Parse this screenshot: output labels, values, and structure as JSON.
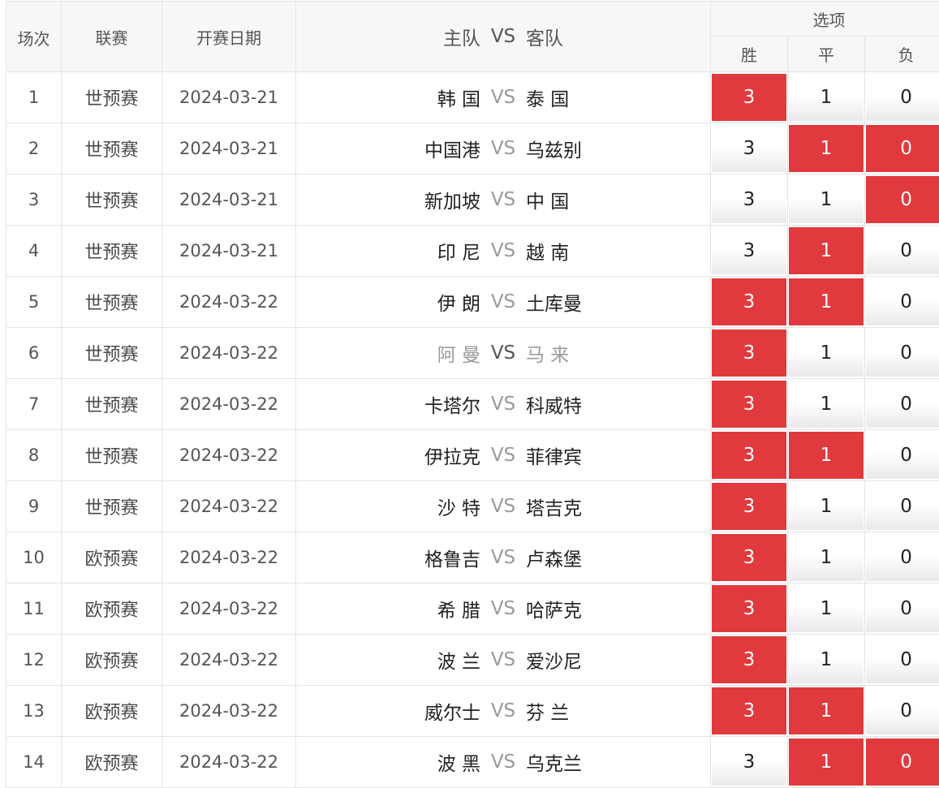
{
  "header": {
    "num": "场次",
    "league": "联赛",
    "date": "开赛日期",
    "home_team": "主队",
    "vs": "VS",
    "away_team": "客队",
    "options": "选项",
    "win": "胜",
    "draw": "平",
    "lose": "负"
  },
  "colors": {
    "selected": "#e03a3e",
    "muted_team": "#9a9a9a",
    "border": "#e4e4e4",
    "header_bg": "#f7f7f7"
  },
  "matches": [
    {
      "num": "1",
      "league": "世预赛",
      "date": "2024-03-21",
      "home": "韩 国",
      "vs": "VS",
      "away": "泰 国",
      "win": "3",
      "draw": "1",
      "lose": "0",
      "selected": [
        true,
        false,
        false
      ],
      "muted": false
    },
    {
      "num": "2",
      "league": "世预赛",
      "date": "2024-03-21",
      "home": "中国港",
      "vs": "VS",
      "away": "乌兹别",
      "win": "3",
      "draw": "1",
      "lose": "0",
      "selected": [
        false,
        true,
        true
      ],
      "muted": false
    },
    {
      "num": "3",
      "league": "世预赛",
      "date": "2024-03-21",
      "home": "新加坡",
      "vs": "VS",
      "away": "中 国",
      "win": "3",
      "draw": "1",
      "lose": "0",
      "selected": [
        false,
        false,
        true
      ],
      "muted": false
    },
    {
      "num": "4",
      "league": "世预赛",
      "date": "2024-03-21",
      "home": "印 尼",
      "vs": "VS",
      "away": "越 南",
      "win": "3",
      "draw": "1",
      "lose": "0",
      "selected": [
        false,
        true,
        false
      ],
      "muted": false
    },
    {
      "num": "5",
      "league": "世预赛",
      "date": "2024-03-22",
      "home": "伊 朗",
      "vs": "VS",
      "away": "土库曼",
      "win": "3",
      "draw": "1",
      "lose": "0",
      "selected": [
        true,
        true,
        false
      ],
      "muted": false
    },
    {
      "num": "6",
      "league": "世预赛",
      "date": "2024-03-22",
      "home": "阿 曼",
      "vs": "VS",
      "away": "马 来",
      "win": "3",
      "draw": "1",
      "lose": "0",
      "selected": [
        true,
        false,
        false
      ],
      "muted": true
    },
    {
      "num": "7",
      "league": "世预赛",
      "date": "2024-03-22",
      "home": "卡塔尔",
      "vs": "VS",
      "away": "科威特",
      "win": "3",
      "draw": "1",
      "lose": "0",
      "selected": [
        true,
        false,
        false
      ],
      "muted": false
    },
    {
      "num": "8",
      "league": "世预赛",
      "date": "2024-03-22",
      "home": "伊拉克",
      "vs": "VS",
      "away": "菲律宾",
      "win": "3",
      "draw": "1",
      "lose": "0",
      "selected": [
        true,
        true,
        false
      ],
      "muted": false
    },
    {
      "num": "9",
      "league": "世预赛",
      "date": "2024-03-22",
      "home": "沙 特",
      "vs": "VS",
      "away": "塔吉克",
      "win": "3",
      "draw": "1",
      "lose": "0",
      "selected": [
        true,
        false,
        false
      ],
      "muted": false
    },
    {
      "num": "10",
      "league": "欧预赛",
      "date": "2024-03-22",
      "home": "格鲁吉",
      "vs": "VS",
      "away": "卢森堡",
      "win": "3",
      "draw": "1",
      "lose": "0",
      "selected": [
        true,
        false,
        false
      ],
      "muted": false
    },
    {
      "num": "11",
      "league": "欧预赛",
      "date": "2024-03-22",
      "home": "希 腊",
      "vs": "VS",
      "away": "哈萨克",
      "win": "3",
      "draw": "1",
      "lose": "0",
      "selected": [
        true,
        false,
        false
      ],
      "muted": false
    },
    {
      "num": "12",
      "league": "欧预赛",
      "date": "2024-03-22",
      "home": "波 兰",
      "vs": "VS",
      "away": "爱沙尼",
      "win": "3",
      "draw": "1",
      "lose": "0",
      "selected": [
        true,
        false,
        false
      ],
      "muted": false
    },
    {
      "num": "13",
      "league": "欧预赛",
      "date": "2024-03-22",
      "home": "威尔士",
      "vs": "VS",
      "away": "芬 兰",
      "win": "3",
      "draw": "1",
      "lose": "0",
      "selected": [
        true,
        true,
        false
      ],
      "muted": false
    },
    {
      "num": "14",
      "league": "欧预赛",
      "date": "2024-03-22",
      "home": "波 黑",
      "vs": "VS",
      "away": "乌克兰",
      "win": "3",
      "draw": "1",
      "lose": "0",
      "selected": [
        false,
        true,
        true
      ],
      "muted": false
    }
  ]
}
